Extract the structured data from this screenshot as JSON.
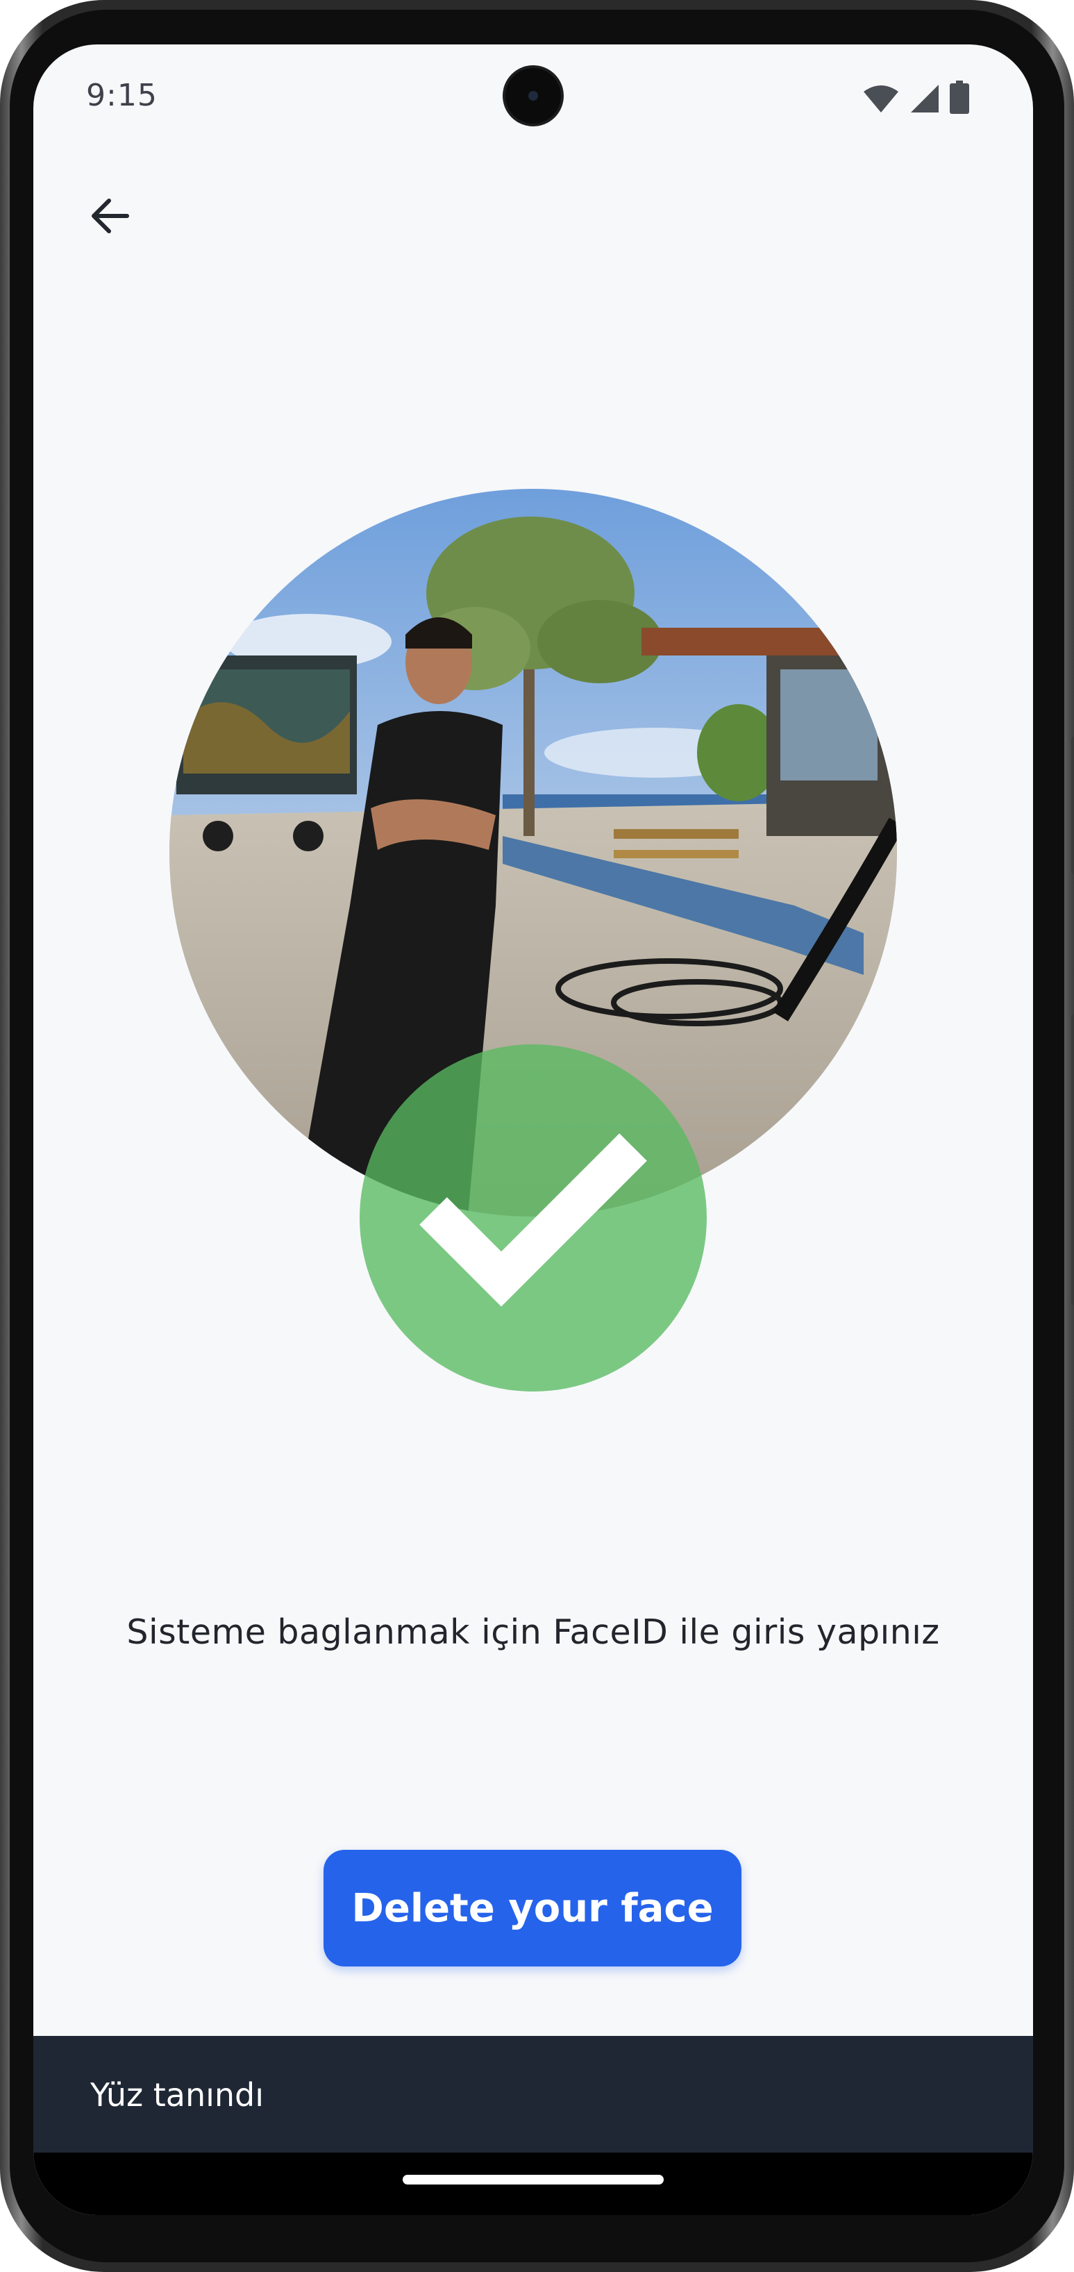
{
  "status_bar": {
    "time": "9:15",
    "icons": [
      "wifi-icon",
      "signal-icon",
      "battery-icon"
    ]
  },
  "header": {
    "back_icon": "arrow-left-icon"
  },
  "main": {
    "photo_icon": "face-photo",
    "badge_icon": "checkmark-icon",
    "instruction": "Sisteme baglanmak için FaceID ile giris yapınız",
    "delete_button_label": "Delete your face"
  },
  "snackbar": {
    "message": "Yüz tanındı"
  },
  "colors": {
    "background": "#f7f8fa",
    "accent": "#2563eb",
    "success": "#58ba62",
    "snackbar": "#1f2735"
  }
}
